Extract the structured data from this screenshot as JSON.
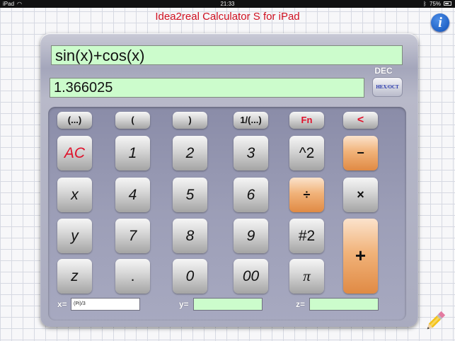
{
  "status_bar": {
    "device": "iPad",
    "time": "21:33",
    "battery": "75%",
    "battery_level": 0.75,
    "wifi_icon": "wifi-icon",
    "bluetooth_icon": "bluetooth-icon"
  },
  "app": {
    "title": "Idea2real Calculator S for iPad",
    "info_label": "i",
    "colors": {
      "title": "#d01020",
      "display_bg": "#ccfccc",
      "orange_key": "#f1b37a",
      "gray_key": "#d8d8d8"
    }
  },
  "display": {
    "expression": "sin(x)+cos(x)",
    "result": "1.366025"
  },
  "mode": {
    "label": "DEC",
    "toggle_label": "HEX/OCT"
  },
  "keys": {
    "row1": [
      "(...)",
      "(",
      ")",
      "1/(...)",
      "Fn",
      "<"
    ],
    "row2": [
      "AC",
      "1",
      "2",
      "3",
      "^2",
      "−"
    ],
    "row3": [
      "x",
      "4",
      "5",
      "6",
      "÷",
      "×"
    ],
    "row4": [
      "y",
      "7",
      "8",
      "9",
      "#2",
      "+"
    ],
    "row5": [
      "z",
      ".",
      "0",
      "00",
      "π"
    ]
  },
  "variables": {
    "x_label": "x=",
    "x_value": "(Pi)/3",
    "y_label": "y=",
    "y_value": "",
    "z_label": "z=",
    "z_value": ""
  },
  "edit_icon": "pencil-icon"
}
